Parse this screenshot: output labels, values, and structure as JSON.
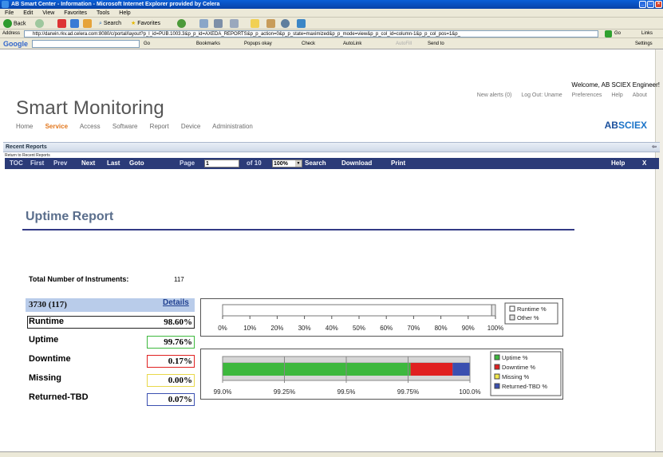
{
  "browser": {
    "title": "AB Smart Center - Information - Microsoft Internet Explorer provided by Celera",
    "menu": [
      "File",
      "Edit",
      "View",
      "Favorites",
      "Tools",
      "Help"
    ],
    "toolbar": {
      "back": "Back",
      "search": "Search",
      "favorites": "Favorites"
    },
    "address_label": "Address",
    "address_url": "http://darwin.rkv.ad.celera.com:8080/c/portal/layout?p_l_id=PUB.1003.3&p_p_id=AXEDA_REPORTS&p_p_action=0&p_p_state=maximized&p_p_mode=view&p_p_col_id=column-1&p_p_col_pos=1&p_",
    "go": "Go",
    "links": "Links",
    "google_label": "Google",
    "google_items": [
      "Go",
      "Bookmarks",
      "Popups okay",
      "Check",
      "AutoLink",
      "AutoFill",
      "Send to",
      "Settings"
    ]
  },
  "header": {
    "welcome": "Welcome, AB SCIEX Engineer!",
    "app_title": "Smart Monitoring",
    "nav": [
      "Home",
      "Service",
      "Access",
      "Software",
      "Report",
      "Device",
      "Administration"
    ],
    "active_nav": "Service",
    "top_links": [
      "New alerts (0)",
      "Log Out: Uname",
      "Preferences",
      "Help",
      "About"
    ],
    "logo_ab": "AB",
    "logo_sciex": "SCIEX"
  },
  "portlet": {
    "title": "Recent Reports",
    "return_link": "Return to Recent Reports"
  },
  "report_toolbar": {
    "toc": "TOC",
    "first": "First",
    "prev": "Prev",
    "next": "Next",
    "last": "Last",
    "goto": "Goto",
    "page_label": "Page",
    "page_value": "1",
    "of_pages": "of 10",
    "zoom": "100%",
    "search": "Search",
    "download": "Download",
    "print": "Print",
    "help": "Help",
    "close": "X"
  },
  "report": {
    "title": "Uptime Report",
    "total_label": "Total Number of Instruments:",
    "total_value": "117",
    "instrument": "3730 (117)",
    "details": "Details",
    "rows": [
      {
        "label": "Runtime",
        "value": "98.60%"
      },
      {
        "label": "Uptime",
        "value": "99.76%"
      },
      {
        "label": "Downtime",
        "value": "0.17%"
      },
      {
        "label": "Missing",
        "value": "0.00%"
      },
      {
        "label": "Returned-TBD",
        "value": "0.07%"
      }
    ]
  },
  "colors": {
    "uptime": "#3db83d",
    "downtime": "#e02020",
    "missing": "#f2e84a",
    "returned": "#3a4fb0",
    "toolbar_bg": "#2b3b78",
    "service_orange": "#e2761c"
  },
  "chart_data": [
    {
      "type": "bar",
      "orientation": "horizontal",
      "stacked": true,
      "xlim": [
        0,
        100
      ],
      "x_ticks": [
        "0%",
        "10%",
        "20%",
        "30%",
        "40%",
        "50%",
        "60%",
        "70%",
        "80%",
        "90%",
        "100%"
      ],
      "series": [
        {
          "name": "Runtime %",
          "values": [
            98.6
          ]
        },
        {
          "name": "Other %",
          "values": [
            1.4
          ]
        }
      ],
      "legend_position": "right"
    },
    {
      "type": "bar",
      "orientation": "horizontal",
      "stacked": true,
      "xlim": [
        99.0,
        100.0
      ],
      "x_ticks": [
        "99.0%",
        "99.25%",
        "99.5%",
        "99.75%",
        "100.0%"
      ],
      "series": [
        {
          "name": "Uptime %",
          "values": [
            99.76
          ]
        },
        {
          "name": "Downtime %",
          "values": [
            0.17
          ]
        },
        {
          "name": "Missing %",
          "values": [
            0.0
          ]
        },
        {
          "name": "Returned-TBD %",
          "values": [
            0.07
          ]
        }
      ],
      "legend_position": "right"
    }
  ]
}
